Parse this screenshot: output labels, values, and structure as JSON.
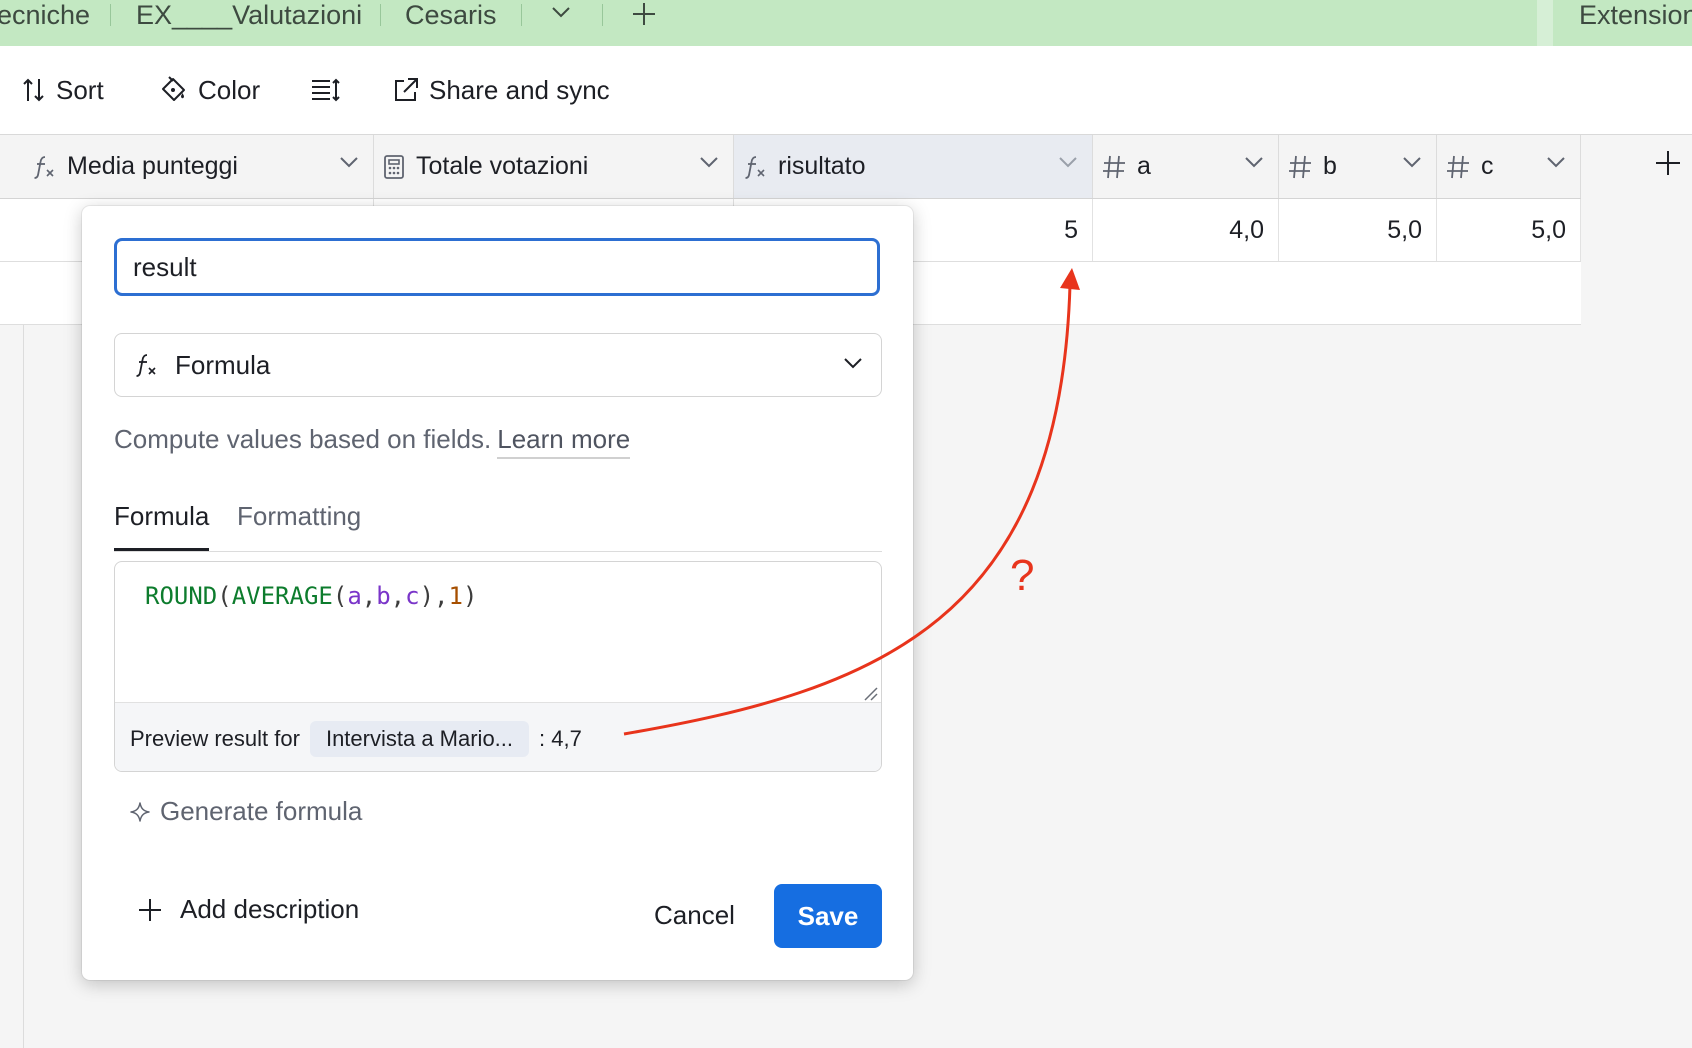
{
  "tabs": {
    "items": [
      "ecniche",
      "EX____Valutazioni",
      "Cesaris"
    ],
    "extensions_label": "Extension"
  },
  "toolbar": {
    "sort_label": "Sort",
    "color_label": "Color",
    "share_label": "Share and sync"
  },
  "columns": [
    {
      "label": "Media punteggi",
      "type_icon": "formula-icon"
    },
    {
      "label": "Totale votazioni",
      "type_icon": "calculator-icon"
    },
    {
      "label": "risultato",
      "type_icon": "formula-icon"
    },
    {
      "label": "a",
      "type_icon": "number-icon"
    },
    {
      "label": "b",
      "type_icon": "number-icon"
    },
    {
      "label": "c",
      "type_icon": "number-icon"
    }
  ],
  "row1": {
    "risultato": "5",
    "a": "4,0",
    "b": "5,0",
    "c": "5,0"
  },
  "field_editor": {
    "name_value": "result",
    "field_type": "Formula",
    "description": "Compute values based on fields.",
    "learn_more": "Learn more",
    "tab_formula": "Formula",
    "tab_formatting": "Formatting",
    "formula_tokens": {
      "round": "ROUND",
      "p1": "(",
      "average": "AVERAGE",
      "p2": "(",
      "a": "a",
      "c1": ",",
      "b": "b",
      "c2": ",",
      "c": "c",
      "p3": ")",
      "c3": ",",
      "one": "1",
      "p4": ")"
    },
    "preview_label": "Preview result for",
    "preview_record": "Intervista a Mario...",
    "preview_value": ": 4,7",
    "generate_label": "Generate formula",
    "add_description_label": "Add description",
    "cancel_label": "Cancel",
    "save_label": "Save"
  },
  "annotation": {
    "mark": "?",
    "color": "#e8341c"
  },
  "colors": {
    "accent": "#166ee1",
    "tabbar": "#c3e8c2",
    "focus": "#2d6fd2"
  }
}
